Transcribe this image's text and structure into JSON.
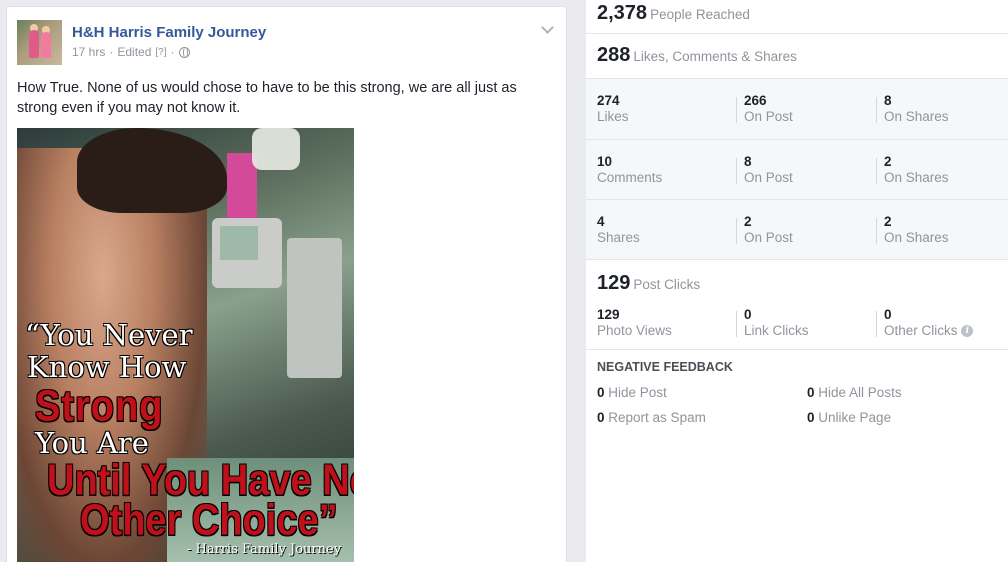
{
  "post": {
    "page_name": "H&H Harris Family Journey",
    "time": "17 hrs",
    "edited": "Edited",
    "edited_hint": "[?]",
    "text": "How True. None of us would chose to have to be this strong, we are all just as strong even if you may not know it.",
    "image_quote": {
      "line1": "“You Never",
      "line2": "Know How",
      "line3": "Strong",
      "line4": "You Are",
      "line5": "Until You Have No",
      "line6": "Other Choice”",
      "signature": "- Harris Family Journey"
    },
    "icons": {
      "privacy": "globe-icon",
      "menu": "chevron-down-icon"
    }
  },
  "insights": {
    "reached": {
      "value": "2,378",
      "label": "People Reached"
    },
    "engagement": {
      "value": "288",
      "label": "Likes, Comments & Shares"
    },
    "likes": {
      "total": "274",
      "total_label": "Likes",
      "on_post": "266",
      "on_post_label": "On Post",
      "on_shares": "8",
      "on_shares_label": "On Shares"
    },
    "comments": {
      "total": "10",
      "total_label": "Comments",
      "on_post": "8",
      "on_post_label": "On Post",
      "on_shares": "2",
      "on_shares_label": "On Shares"
    },
    "shares": {
      "total": "4",
      "total_label": "Shares",
      "on_post": "2",
      "on_post_label": "On Post",
      "on_shares": "2",
      "on_shares_label": "On Shares"
    },
    "clicks": {
      "value": "129",
      "label": "Post Clicks",
      "photo_views": "129",
      "photo_views_label": "Photo Views",
      "link_clicks": "0",
      "link_clicks_label": "Link Clicks",
      "other_clicks": "0",
      "other_clicks_label": "Other Clicks",
      "info_glyph": "i"
    },
    "negative": {
      "title": "NEGATIVE FEEDBACK",
      "hide_post": {
        "value": "0",
        "label": "Hide Post"
      },
      "hide_all": {
        "value": "0",
        "label": "Hide All Posts"
      },
      "spam": {
        "value": "0",
        "label": "Report as Spam"
      },
      "unlike": {
        "value": "0",
        "label": "Unlike Page"
      }
    }
  },
  "colors": {
    "link": "#365899",
    "muted": "#90949c",
    "text": "#1d2129",
    "quote_red": "#c0111b"
  }
}
